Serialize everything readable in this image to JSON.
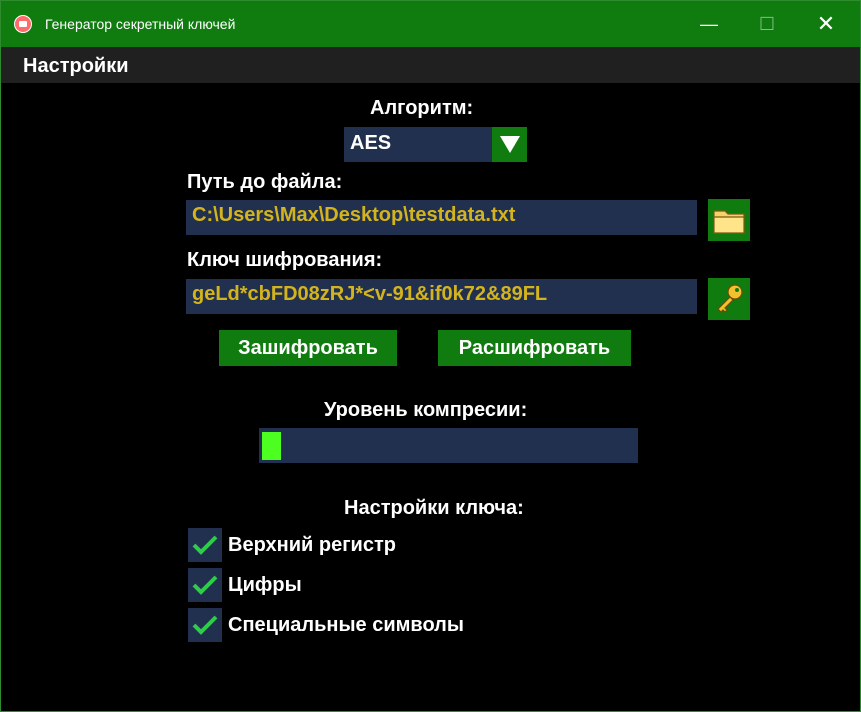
{
  "window": {
    "title": "Генератор секретный ключей",
    "minimize_glyph": "—",
    "maximize_glyph": "☐",
    "close_glyph": "✕"
  },
  "menu": {
    "settings": "Настройки"
  },
  "algorithm": {
    "label": "Алгоритм:",
    "value": "AES"
  },
  "file": {
    "label": "Путь до файла:",
    "value": "C:\\Users\\Max\\Desktop\\testdata.txt",
    "button_icon": "folder-icon"
  },
  "key": {
    "label": "Ключ шифрования:",
    "value": "geLd*cbFD08zRJ*<v-91&if0k72&89FL",
    "button_icon": "key-icon"
  },
  "actions": {
    "encrypt": "Зашифровать",
    "decrypt": "Расшифровать"
  },
  "compression": {
    "label": "Уровень компресии:",
    "level_fraction": 0.05
  },
  "key_settings": {
    "label": "Настройки ключа:",
    "options": [
      {
        "label": "Верхний регистр",
        "checked": true
      },
      {
        "label": "Цифры",
        "checked": true
      },
      {
        "label": "Специальные символы",
        "checked": true
      }
    ]
  },
  "colors": {
    "accent_green": "#107c10",
    "field_bg": "#21304f",
    "field_text": "#d4b41c",
    "progress_fill": "#4cff20",
    "check_green": "#2fcc4a"
  }
}
